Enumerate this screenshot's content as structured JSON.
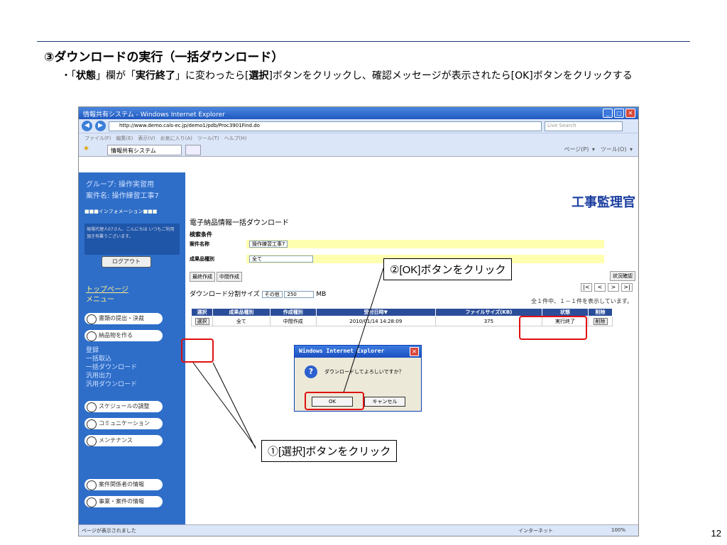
{
  "slide": {
    "title": "③ダウンロードの実行（一括ダウンロード）",
    "desc_pre": "・「",
    "desc_b1": "状態",
    "desc_mid1": "」欄が「",
    "desc_b2": "実行終了",
    "desc_mid2": "」に変わったら[",
    "desc_b3": "選択",
    "desc_mid3": "]ボタンをクリックし、確認メッセージが表示されたら[OK]ボタンをクリックする",
    "page_number": "12"
  },
  "browser": {
    "title": "情報共有システム - Windows Internet Explorer",
    "address": "http://www.demo.cals-ec.jp/demo1/pdb/Proc3901Find.do",
    "search_placeholder": "Live Search",
    "menu": "ファイル(F)　編集(E)　表示(V)　お気に入り(A)　ツール(T)　ヘルプ(H)",
    "tab_label": "情報共有システム",
    "tools": "ページ(P) ▾　ツール(O) ▾",
    "status_left": "ページが表示されました",
    "status_net": "インターネット",
    "status_zoom": "100%"
  },
  "sidebar": {
    "group": "グループ: 操作実習用",
    "project": "案件名: 操作練習工事7",
    "info": "■■■インフォメーション■■■",
    "message": "現場代理人07さん、こんにちは いつもご利用頂き有難うございます。",
    "logout": "ログアウト",
    "top": "トップページ",
    "menu": "メニュー",
    "btn_docs": "書類の提出・決裁",
    "btn_deliverables": "納品物を作る",
    "sub_items": [
      "登録",
      "一括取込",
      "一括ダウンロード",
      "汎用出力",
      "汎用ダウンロード"
    ],
    "btn_schedule": "スケジュールの調整",
    "btn_comm": "コミュニケーション",
    "btn_maint": "メンテナンス",
    "btn_people": "案件関係者の情報",
    "btn_business": "事業・案件の情報"
  },
  "main": {
    "logo": "工事監理官",
    "page_title": "電子納品情報一括ダウンロード",
    "cond_header": "検索条件",
    "cond_name_label": "案件名称",
    "cond_name_value": "操作練習工事7",
    "cond_type_label": "成果品種別",
    "cond_type_value": "全て",
    "tab_final": "最終作成",
    "tab_mid": "中間作成",
    "status_check": "状況確認",
    "split_label": "ダウンロード分割サイズ",
    "split_select": "その他",
    "split_value": "250",
    "split_unit": "MB",
    "pager": [
      "|<",
      "<",
      ">",
      ">|"
    ],
    "count": "全１件中、１－１件を表示しています。",
    "columns": [
      "選択",
      "成果品種別",
      "作成種別",
      "受付日時▼",
      "ファイルサイズ(KB)",
      "状態",
      "削除"
    ],
    "row": {
      "select": "選択",
      "type": "全て",
      "kind": "中間作成",
      "date": "2010/01/14 14:28:09",
      "size": "375",
      "status": "実行終了",
      "delete": "削除"
    }
  },
  "dialog": {
    "title": "Windows Internet Explorer",
    "message": "ダウンロードしてよろしいですか？",
    "ok": "OK",
    "cancel": "キャンセル"
  },
  "callouts": {
    "ok": "②[OK]ボタンをクリック",
    "select": "①[選択]ボタンをクリック"
  },
  "colors": {
    "highlight": "#e01010",
    "sidebar": "#2e6ec9",
    "title_bar": "#2058c0"
  }
}
